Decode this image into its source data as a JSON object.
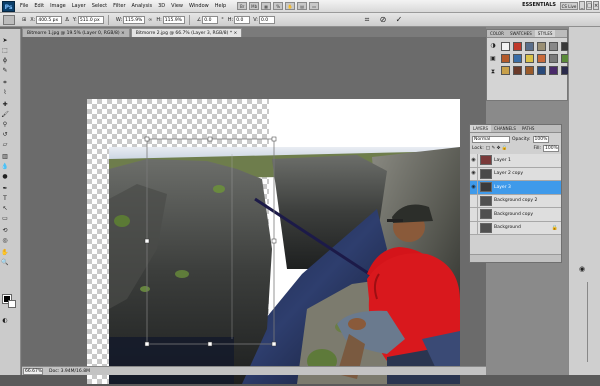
{
  "menubar": {
    "logo": "Ps",
    "items": [
      "File",
      "Edit",
      "Image",
      "Layer",
      "Select",
      "Filter",
      "Analysis",
      "3D",
      "View",
      "Window",
      "Help"
    ],
    "workspace": "ESSENTIALS",
    "cs_live": "CS Live"
  },
  "options": {
    "x_value": "400.5 px",
    "y_value": "511.0 px",
    "w_label": "W:",
    "w_value": "115.9%",
    "h_label": "H:",
    "h_value": "115.9%",
    "angle_value": "0.0",
    "h_skew_value": "0.0",
    "v_skew_value": "0.0",
    "cancel_icon": "cancel-transform-icon",
    "commit_icon": "commit-transform-icon"
  },
  "tabs": [
    {
      "label": "Bitmorre 1.jpg @ 19.5% (Layer 0, RGB/8) ×",
      "active": false
    },
    {
      "label": "Bitmorre 2.jpg @ 66.7% (Layer 3, RGB/8) * ×",
      "active": true
    }
  ],
  "status": {
    "zoom": "66.67%",
    "doc": "Doc: 3.94M/16.8M"
  },
  "style_panel": {
    "tabs": [
      "COLOR",
      "SWATCHES",
      "STYLES"
    ],
    "active_tab": "STYLES",
    "style_colors": [
      "#f2f2f2",
      "#c0392b",
      "#5a6e8a",
      "#9a8f74",
      "#888888",
      "#3a3a3a",
      "#b45a2a",
      "#3a6ea8",
      "#d8c14a",
      "#c86a3a",
      "#7a7a7a",
      "#5a8a3a",
      "#c8a04a",
      "#6a3a2a",
      "#9a5a2a",
      "#2a4a7a",
      "#4a2a6a",
      "#2a2a4a"
    ]
  },
  "layers": {
    "tabs": [
      "LAYERS",
      "CHANNELS",
      "PATHS"
    ],
    "blend_mode": "Normal",
    "opacity_label": "Opacity:",
    "opacity": "100%",
    "lock_label": "Lock:",
    "fill_label": "Fill:",
    "fill": "100%",
    "items": [
      {
        "name": "Layer 1",
        "visible": true,
        "selected": false,
        "thumb": "#7a3a3a"
      },
      {
        "name": "Layer 2 copy",
        "visible": true,
        "selected": false,
        "thumb": "#4a4a4a"
      },
      {
        "name": "Layer 3",
        "visible": true,
        "selected": true,
        "thumb": "#3a3a3a"
      },
      {
        "name": "Background copy 2",
        "visible": false,
        "selected": false,
        "thumb": "#505050"
      },
      {
        "name": "Background copy",
        "visible": false,
        "selected": false,
        "thumb": "#505050"
      },
      {
        "name": "Background",
        "visible": false,
        "selected": false,
        "thumb": "#505050",
        "locked": true
      }
    ]
  },
  "colors": {
    "selection_blue": "#3f9aea",
    "accent_red": "#d4141a"
  }
}
